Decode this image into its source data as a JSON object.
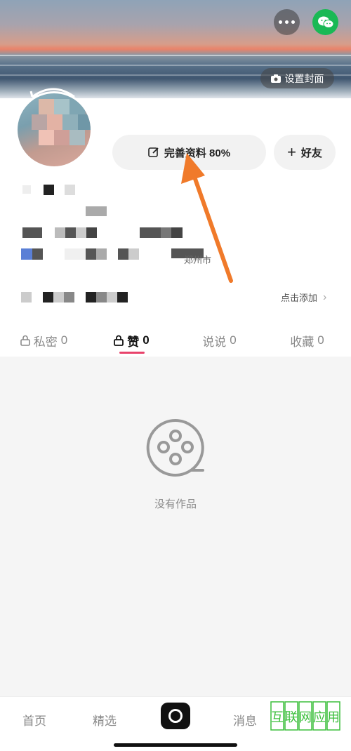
{
  "header": {
    "set_cover_label": "设置封面"
  },
  "profile": {
    "complete_label": "完善资料 80%",
    "add_friend_label": "好友",
    "location_fragment": "郑州市",
    "add_prompt_label": "点击添加"
  },
  "tabs": [
    {
      "label": "私密",
      "count": "0",
      "locked": true,
      "active": false
    },
    {
      "label": "赞",
      "count": "0",
      "locked": true,
      "active": true
    },
    {
      "label": "说说",
      "count": "0",
      "locked": false,
      "active": false
    },
    {
      "label": "收藏",
      "count": "0",
      "locked": false,
      "active": false
    }
  ],
  "empty_state": {
    "text": "没有作品",
    "icon": "film-reel-icon"
  },
  "bottom_nav": {
    "home": "首页",
    "featured": "精选",
    "messages": "消息",
    "capture_icon": "camera-capture-icon"
  },
  "watermark": {
    "text": "互联网应用"
  },
  "colors": {
    "accent": "#e8436b",
    "annotation_arrow": "#f07a2a",
    "wechat": "#19b955"
  }
}
